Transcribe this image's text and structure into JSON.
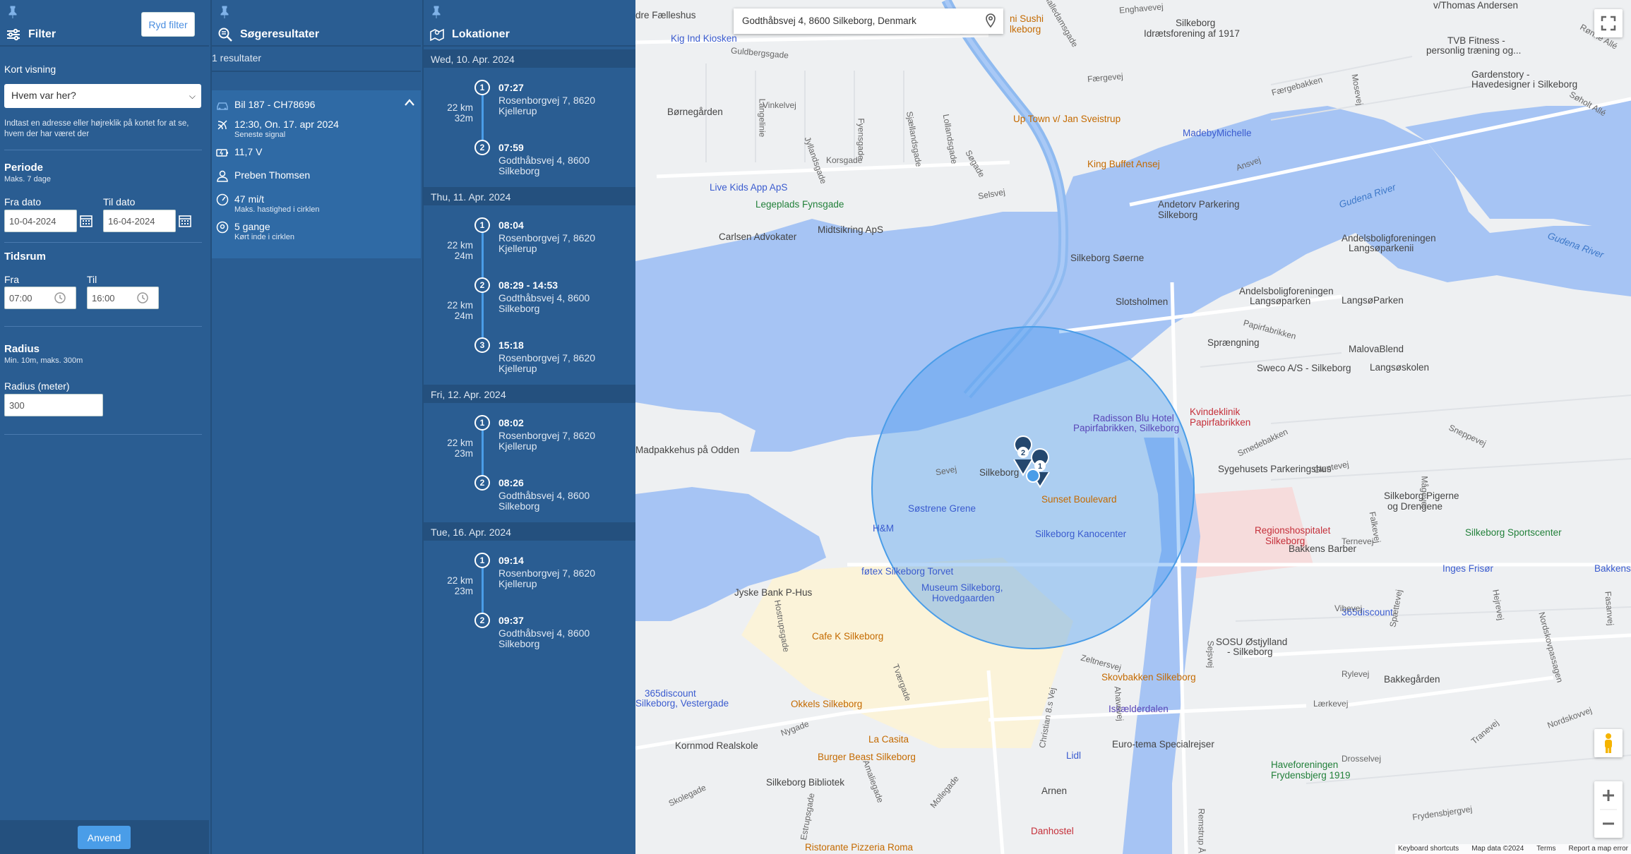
{
  "filter": {
    "title": "Filter",
    "clear_label": "Ryd filter",
    "map_view_label": "Kort visning",
    "map_view_value": "Hvem var her?",
    "help_text": "Indtast en adresse eller højreklik på kortet for at se, hvem der har været der",
    "period_title": "Periode",
    "period_sub": "Maks. 7 dage",
    "from_date_label": "Fra dato",
    "from_date_value": "10-04-2024",
    "to_date_label": "Til dato",
    "to_date_value": "16-04-2024",
    "timespan_title": "Tidsrum",
    "from_label": "Fra",
    "from_time": "07:00",
    "to_label": "Til",
    "to_time": "16:00",
    "radius_title": "Radius",
    "radius_sub": "Min. 10m, maks. 300m",
    "radius_label": "Radius (meter)",
    "radius_value": "300",
    "apply_label": "Anvend"
  },
  "results": {
    "title": "Søgeresultater",
    "count": "1 resultater",
    "card": {
      "vehicle": "Bil 187 - CH78696",
      "last_signal": "12:30, On. 17. apr 2024",
      "last_signal_sub": "Seneste signal",
      "voltage": "11,7 V",
      "driver": "Preben Thomsen",
      "max_speed": "47 mi/t",
      "max_speed_sub": "Maks. hastighed i cirklen",
      "times": "5 gange",
      "times_sub": "Kørt inde i cirklen"
    }
  },
  "locations": {
    "title": "Lokationer",
    "days": [
      {
        "header": "Wed, 10. Apr. 2024",
        "stops": [
          {
            "n": "1",
            "time": "07:27",
            "addr1": "Rosenborgvej 7, 8620",
            "addr2": "Kjellerup"
          },
          {
            "n": "2",
            "time": "07:59",
            "addr1": "Godthåbsvej 4, 8600",
            "addr2": "Silkeborg"
          }
        ],
        "legs": [
          {
            "km": "22 km",
            "min": "32m"
          }
        ]
      },
      {
        "header": "Thu, 11. Apr. 2024",
        "stops": [
          {
            "n": "1",
            "time": "08:04",
            "addr1": "Rosenborgvej 7, 8620",
            "addr2": "Kjellerup"
          },
          {
            "n": "2",
            "time": "08:29 - 14:53",
            "addr1": "Godthåbsvej 4, 8600",
            "addr2": "Silkeborg"
          },
          {
            "n": "3",
            "time": "15:18",
            "addr1": "Rosenborgvej 7, 8620",
            "addr2": "Kjellerup"
          }
        ],
        "legs": [
          {
            "km": "22 km",
            "min": "24m"
          },
          {
            "km": "22 km",
            "min": "24m"
          }
        ]
      },
      {
        "header": "Fri, 12. Apr. 2024",
        "stops": [
          {
            "n": "1",
            "time": "08:02",
            "addr1": "Rosenborgvej 7, 8620",
            "addr2": "Kjellerup"
          },
          {
            "n": "2",
            "time": "08:26",
            "addr1": "Godthåbsvej 4, 8600",
            "addr2": "Silkeborg"
          }
        ],
        "legs": [
          {
            "km": "22 km",
            "min": "23m"
          }
        ]
      },
      {
        "header": "Tue, 16. Apr. 2024",
        "stops": [
          {
            "n": "1",
            "time": "09:14",
            "addr1": "Rosenborgvej 7, 8620",
            "addr2": "Kjellerup"
          },
          {
            "n": "2",
            "time": "09:37",
            "addr1": "Godthåbsvej 4, 8600",
            "addr2": "Silkeborg"
          }
        ],
        "legs": [
          {
            "km": "22 km",
            "min": "23m"
          }
        ]
      }
    ]
  },
  "map": {
    "search_value": "Godthåbsvej 4, 8600 Silkeborg, Denmark",
    "pin_labels": [
      "2",
      "1"
    ],
    "footer": [
      "Keyboard shortcuts",
      "Map data ©2024",
      "Terms",
      "Report a map error"
    ],
    "labels": {
      "faelleshus": "dre Fælleshus",
      "sushi": "ni Sushi",
      "sushi2": "lkeborg",
      "kig_ind": "Kig Ind Kiosken",
      "silkeborg_if": "Silkeborg",
      "silkeborg_if2": "Idrætsforening af 1917",
      "thomas": "v/Thomas Andersen",
      "tvb": "TVB Fitness -",
      "tvb2": "personlig træning og...",
      "gardenstory": "Gardenstory -",
      "gardenstory2": "Havedesigner i Silkeborg",
      "bornegarden": "Børnegården",
      "up_town": "Up Town v/ Jan Sveistrup",
      "madeby": "MadebyMichelle",
      "king_buffet": "King Buffet Ansej",
      "live_kids": "Live Kids App ApS",
      "legeplads": "Legeplads Fynsgade",
      "andetorv": "Andetorv Parkering",
      "andetorv2": "Silkeborg",
      "gudena1": "Gudena River",
      "gudena2": "Gudena River",
      "carlsen": "Carlsen Advokater",
      "midtsikring": "Midtsikring ApS",
      "soerne": "Silkeborg Søerne",
      "andelsbolig1": "Andelsboligforeningen",
      "andelsbolig1b": "Langsøparkenii",
      "slotsholmen": "Slotsholmen",
      "andelsbolig2": "Andelsboligforeningen",
      "andelsbolig2b": "Langsøparken",
      "langsoparken": "LangsøParken",
      "spraengning": "Sprængning",
      "malovablend": "MalovaBlend",
      "sweco": "Sweco A/S - Silkeborg",
      "langsoskolen": "Langsøskolen",
      "kvindeklinik": "Kvindeklinik",
      "kvindeklinik2": "Papirfabrikken",
      "radisson": "Radisson Blu Hotel",
      "radisson2": "Papirfabrikken, Silkeborg",
      "madpakkehus": "Madpakkehus på Odden",
      "silkeborg_center": "Silkeborg",
      "sygehus": "Sygehusets Parkeringshus",
      "sunset": "Sunset Boulevard",
      "sostrene": "Søstrene Grene",
      "hm": "H&M",
      "kanocenter": "Silkeborg Kanocenter",
      "regionshosp": "Regionshospitalet",
      "regionshosp2": "Silkeborg",
      "pigerne": "Silkeborg Pigerne",
      "pigerne2": "og Drengene",
      "sportscenter": "Silkeborg Sportscenter",
      "bakkens_barber": "Bakkens Barber",
      "inges": "Inges Frisør",
      "bakkens_apotek": "Bakkens A",
      "fotex": "føtex Silkeborg Torvet",
      "museum": "Museum Silkeborg,",
      "museum2": "Hovedgaarden",
      "jyske": "Jyske Bank P-Hus",
      "cafe_k": "Cafe K Silkeborg",
      "discount1": "365discount",
      "discount2": "365discount",
      "discount2b": "Silkeborg, Vestergade",
      "sosu": "SOSU Østjylland",
      "sosu2": "- Silkeborg",
      "okkels": "Okkels Silkeborg",
      "skovbakken": "Skovbakken Silkeborg",
      "bakkegarden": "Bakkegården",
      "iskaelderdalen": "Iskælderdalen",
      "kornmod": "Kornmod Realskole",
      "la_casita": "La Casita",
      "burger_beast": "Burger Beast Silkeborg",
      "lidl": "Lidl",
      "eurotema": "Euro-tema Specialrejser",
      "haveforeningen": "Haveforeningen",
      "haveforeningen2": "Frydensbjerg 1919",
      "bibliotek": "Silkeborg Bibliotek",
      "arnen": "Arnen",
      "danhostel": "Danhostel",
      "ristorante": "Ristorante Pizzeria Roma"
    },
    "streets": [
      "Malledamsgade",
      "Enghavevej",
      "Guldbergsgade",
      "Færgevej",
      "Vinkelvej",
      "Langelinie",
      "Korsgade",
      "Ansvej",
      "Selsvej",
      "Sevej",
      "Papirfabrikken",
      "Smedebakken",
      "Glentevej",
      "Ternevej",
      "Vibevej",
      "Rylevej",
      "Lærkevej",
      "Drosselvej",
      "Frydensbjergvej",
      "Nordskovvej",
      "Zeltnersvej",
      "Christian 8.s Vej",
      "Remstrup Å",
      "Skolegade",
      "Nygade",
      "Tværgade",
      "Hostrupsgade",
      "Estrupsgade",
      "Sejsvej",
      "Sneppevej",
      "Falkevej",
      "Mågevej",
      "Spættevej",
      "Hejrevej",
      "Rønne Allé",
      "Søholt Allé",
      "Fyensgade",
      "Jyllandsgade",
      "Sjællandsgade",
      "Lollandsgade",
      "Søgade",
      "Amaliegade",
      "Mollegade",
      "Nordskovpassagen",
      "Tranevej",
      "Ahavevej",
      "Fasanvej",
      "Færgebakken",
      "Mosevej"
    ]
  }
}
